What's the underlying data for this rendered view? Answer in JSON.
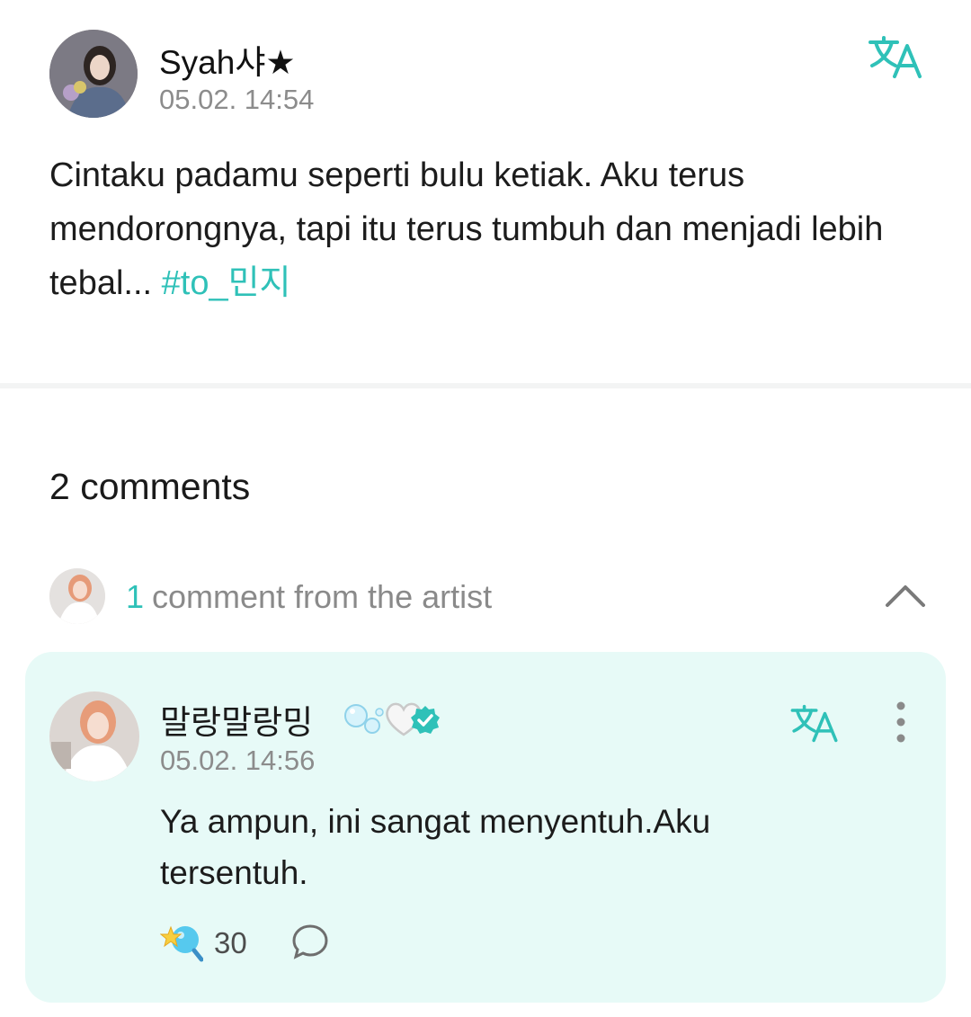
{
  "post": {
    "author_name": "Syah샤★",
    "timestamp": "05.02. 14:54",
    "body_text": "Cintaku padamu seperti bulu ketiak. Aku terus mendorongnya, tapi itu terus tumbuh dan menjadi lebih tebal... ",
    "hashtag": "#to_민지",
    "translate_icon": "translate-icon"
  },
  "comments": {
    "count_label": "2 comments",
    "artist_summary": {
      "count": "1",
      "label": "comment from the artist",
      "toggle_icon": "chevron-up-icon"
    },
    "artist_comment": {
      "author_name": "말랑말랑밍",
      "author_emoji": [
        "bubbles-emoji",
        "white-heart-emoji"
      ],
      "verified_icon": "verified-badge-icon",
      "timestamp": "05.02. 14:56",
      "text": "Ya ampun, ini sangat menyentuh.Aku tersentuh.",
      "like_count": "30",
      "like_icon": "star-bubble-reaction-icon",
      "reply_icon": "reply-bubble-icon",
      "more_icon": "more-vertical-icon"
    }
  },
  "colors": {
    "accent": "#2fc1b8",
    "card_background": "#e7faf7",
    "secondary_text": "#8c8c8c"
  }
}
